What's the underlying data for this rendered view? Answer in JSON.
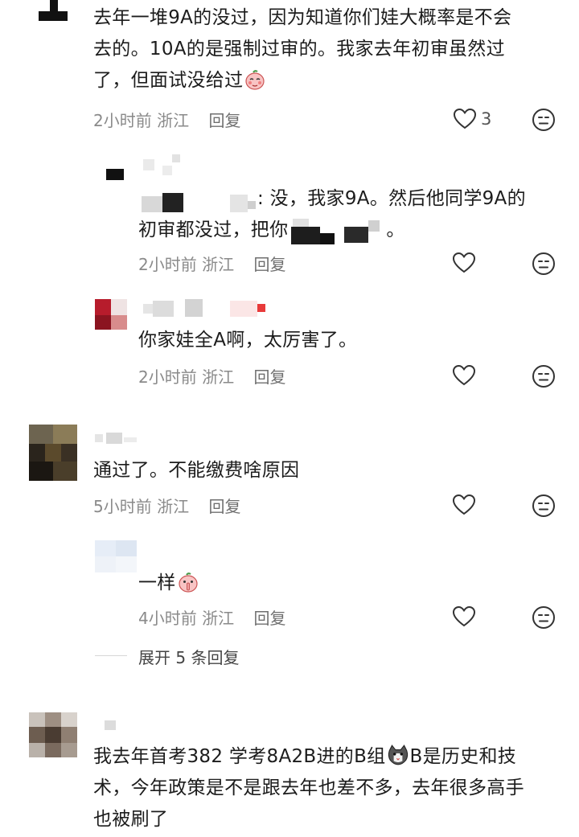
{
  "comments": [
    {
      "id": "c1",
      "text_lines": [
        "去年一堆9A的没过，因为知道你们娃大概率是不会",
        "去的。10A的是强制过审的。我家去年初审虽然过",
        "了，但面试没给过"
      ],
      "time": "2小时前",
      "location": "浙江",
      "reply_label": "回复",
      "like_count": "3"
    },
    {
      "id": "r1",
      "text_lines": [
        ": 没，我家9A。然后他同学9A的",
        "初审都没过，把你",
        "。"
      ],
      "time": "2小时前",
      "location": "浙江",
      "reply_label": "回复"
    },
    {
      "id": "r2",
      "text_lines": [
        "你家娃全A啊，太厉害了。"
      ],
      "time": "2小时前",
      "location": "浙江",
      "reply_label": "回复"
    },
    {
      "id": "c2",
      "text_lines": [
        "通过了。不能缴费啥原因"
      ],
      "time": "5小时前",
      "location": "浙江",
      "reply_label": "回复"
    },
    {
      "id": "r3",
      "text_lines": [
        "一样"
      ],
      "time": "4小时前",
      "location": "浙江",
      "reply_label": "回复"
    },
    {
      "id": "c3",
      "text_lines": [
        "我去年首考382 学考8A2B进的B组",
        "B是历史和技",
        "术，今年政策是不是跟去年也差不多，去年很多高手",
        "也被刷了"
      ]
    }
  ],
  "expand_replies": "展开 5 条回复",
  "icons": {
    "like": "heart-outline-icon",
    "dislike": "meh-face-icon",
    "emoji_blush": "blushing-peach-emoji-icon",
    "emoji_shush": "shushing-peach-emoji-icon",
    "emoji_cat": "cat-face-emoji-icon"
  },
  "colors": {
    "text": "#1c1c1c",
    "meta": "#8a8a8a",
    "icon": "#333333",
    "divider": "#d6d6d6"
  }
}
